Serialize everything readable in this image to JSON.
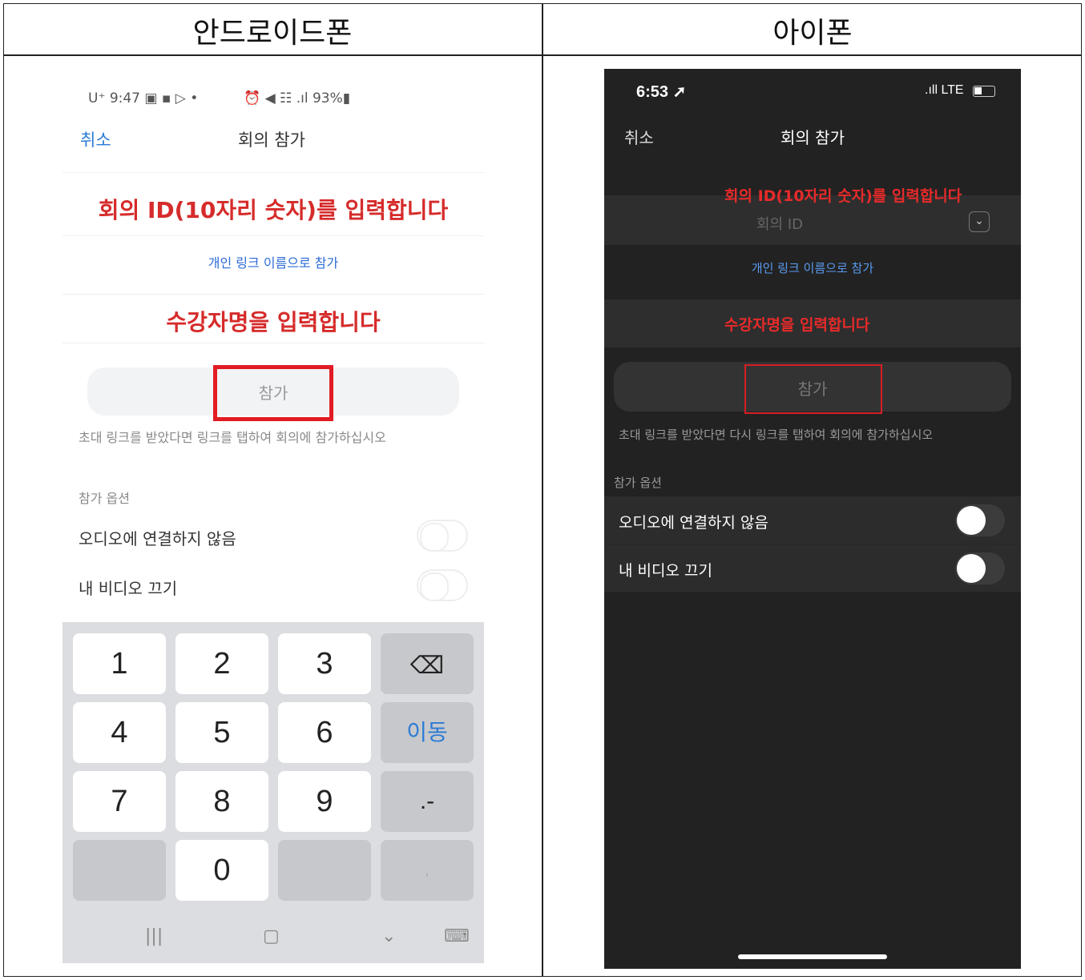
{
  "table": {
    "header_left": "안드로이드폰",
    "header_right": "아이폰"
  },
  "android": {
    "status_left": "U⁺ 9:47 ▣ ▪ ▷ •",
    "status_right": "⏰ ◀ ☷ .ıl 93%▮",
    "cancel": "취소",
    "title": "회의 참가",
    "instruction_id": "회의 ID(10자리 숫자)를 입력합니다",
    "personal_link": "개인 링크 이름으로 참가",
    "instruction_name": "수강자명을 입력합니다",
    "join_button": "참가",
    "hint": "초대 링크를 받았다면 링크를 탭하여 회의에 참가하십시오",
    "options_header": "참가 옵션",
    "option_audio": "오디오에 연결하지 않음",
    "option_video": "내 비디오 끄기",
    "keys": {
      "k1": "1",
      "k2": "2",
      "k3": "3",
      "k4": "4",
      "k5": "5",
      "k6": "6",
      "k7": "7",
      "k8": "8",
      "k9": "9",
      "k0": "0",
      "backspace": "⌫",
      "go": "이동",
      "dot_dash": ".-",
      "comma": ","
    },
    "nav": {
      "recent": "|||",
      "home": "▢",
      "back": "⌄",
      "keyboard": "⌨"
    }
  },
  "iphone": {
    "time": "6:53 ➚",
    "status": ".ıll LTE",
    "cancel": "취소",
    "title": "회의 참가",
    "instruction_id": "회의 ID(10자리 숫자)를 입력합니다",
    "placeholder_id": "회의 ID",
    "chevron": "⌄",
    "personal_link": "개인 링크 이름으로 참가",
    "instruction_name": "수강자명을 입력합니다",
    "join_button": "참가",
    "hint": "초대 링크를 받았다면 다시 링크를 탭하여 회의에 참가하십시오",
    "options_header": "참가 옵션",
    "option_audio": "오디오에 연결하지 않음",
    "option_video": "내 비디오 끄기"
  },
  "colors": {
    "instruction_red": "#d62b2b",
    "highlight_box": "#e21b24",
    "link_blue": "#2b7bd6"
  }
}
